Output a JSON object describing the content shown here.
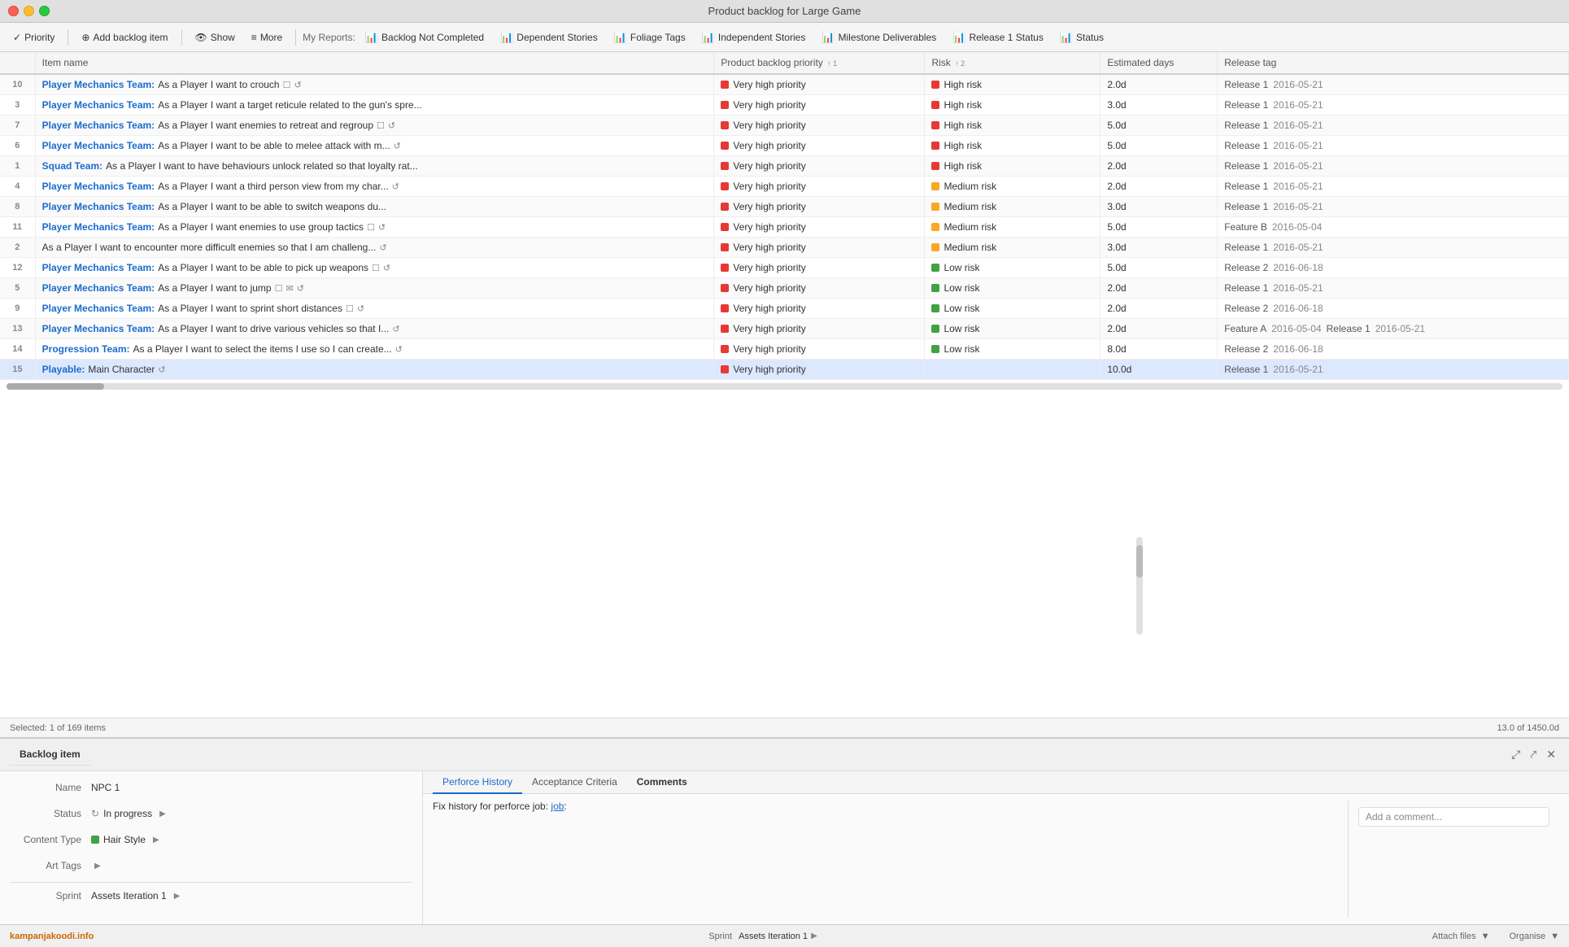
{
  "titlebar": {
    "title": "Product backlog for Large Game"
  },
  "toolbar": {
    "priority_label": "Priority",
    "add_backlog_label": "Add backlog item",
    "show_label": "Show",
    "more_label": "More",
    "reports_label": "My Reports:",
    "items": [
      "Backlog Not Completed",
      "Dependent Stories",
      "Foliage Tags",
      "Independent Stories",
      "Milestone Deliverables",
      "Release 1 Status",
      "Status"
    ]
  },
  "table": {
    "columns": {
      "num": "#",
      "item_name": "Item name",
      "backlog_priority": "Product backlog priority",
      "backlog_sort": "1",
      "risk": "Risk",
      "risk_sort": "2",
      "estimated_days": "Estimated days",
      "release_tag": "Release tag"
    },
    "rows": [
      {
        "num": "10",
        "team": "Player Mechanics Team:",
        "text": " As a Player I want to crouch",
        "has_checkbox": true,
        "has_chat": true,
        "priority": "Very high priority",
        "priority_color": "red",
        "risk": "High risk",
        "risk_color": "red",
        "est_days": "2.0d",
        "tags": [
          {
            "label": "Release 1",
            "date": "2016-05-21"
          }
        ]
      },
      {
        "num": "3",
        "team": "Player Mechanics Team:",
        "text": " As a Player I want a target reticule related to the gun's spre...",
        "has_checkbox": false,
        "has_chat": false,
        "priority": "Very high priority",
        "priority_color": "red",
        "risk": "High risk",
        "risk_color": "red",
        "est_days": "3.0d",
        "tags": [
          {
            "label": "Release 1",
            "date": "2016-05-21"
          }
        ]
      },
      {
        "num": "7",
        "team": "Player Mechanics Team:",
        "text": " As a Player I want enemies to retreat and regroup",
        "has_checkbox": true,
        "has_chat": true,
        "priority": "Very high priority",
        "priority_color": "red",
        "risk": "High risk",
        "risk_color": "red",
        "est_days": "5.0d",
        "tags": [
          {
            "label": "Release 1",
            "date": "2016-05-21"
          }
        ]
      },
      {
        "num": "6",
        "team": "Player Mechanics Team:",
        "text": " As a Player I want to be able to melee attack with m...",
        "has_checkbox": false,
        "has_chat": true,
        "priority": "Very high priority",
        "priority_color": "red",
        "risk": "High risk",
        "risk_color": "red",
        "est_days": "5.0d",
        "tags": [
          {
            "label": "Release 1",
            "date": "2016-05-21"
          }
        ]
      },
      {
        "num": "1",
        "team": "Squad Team:",
        "text": " As a Player I want to have behaviours unlock related so that loyalty rat...",
        "has_checkbox": false,
        "has_chat": false,
        "priority": "Very high priority",
        "priority_color": "red",
        "risk": "High risk",
        "risk_color": "red",
        "est_days": "2.0d",
        "tags": [
          {
            "label": "Release 1",
            "date": "2016-05-21"
          }
        ]
      },
      {
        "num": "4",
        "team": "Player Mechanics Team:",
        "text": " As a Player I want a third person view from my char...",
        "has_checkbox": false,
        "has_chat": true,
        "priority": "Very high priority",
        "priority_color": "red",
        "risk": "Medium risk",
        "risk_color": "yellow",
        "est_days": "2.0d",
        "tags": [
          {
            "label": "Release 1",
            "date": "2016-05-21"
          }
        ]
      },
      {
        "num": "8",
        "team": "Player Mechanics Team:",
        "text": " As a Player I want to be able to switch weapons du...",
        "has_checkbox": false,
        "has_chat": false,
        "priority": "Very high priority",
        "priority_color": "red",
        "risk": "Medium risk",
        "risk_color": "yellow",
        "est_days": "3.0d",
        "tags": [
          {
            "label": "Release 1",
            "date": "2016-05-21"
          }
        ]
      },
      {
        "num": "11",
        "team": "Player Mechanics Team:",
        "text": " As a Player I want enemies to use group tactics",
        "has_checkbox": true,
        "has_chat": true,
        "priority": "Very high priority",
        "priority_color": "red",
        "risk": "Medium risk",
        "risk_color": "yellow",
        "est_days": "5.0d",
        "tags": [
          {
            "label": "Feature B",
            "date": "2016-05-04"
          }
        ]
      },
      {
        "num": "2",
        "team": "",
        "text": "As a Player I want to encounter more difficult enemies so that I am challeng...",
        "has_checkbox": false,
        "has_chat": true,
        "priority": "Very high priority",
        "priority_color": "red",
        "risk": "Medium risk",
        "risk_color": "yellow",
        "est_days": "3.0d",
        "tags": [
          {
            "label": "Release 1",
            "date": "2016-05-21"
          }
        ]
      },
      {
        "num": "12",
        "team": "Player Mechanics Team:",
        "text": " As a Player I want to be able to pick up weapons",
        "has_checkbox": true,
        "has_chat": true,
        "priority": "Very high priority",
        "priority_color": "red",
        "risk": "Low risk",
        "risk_color": "green",
        "est_days": "5.0d",
        "tags": [
          {
            "label": "Release 2",
            "date": "2016-06-18"
          }
        ]
      },
      {
        "num": "5",
        "team": "Player Mechanics Team:",
        "text": " As a Player I want to jump",
        "has_checkbox": true,
        "has_mail": true,
        "has_chat2": true,
        "priority": "Very high priority",
        "priority_color": "red",
        "risk": "Low risk",
        "risk_color": "green",
        "est_days": "2.0d",
        "tags": [
          {
            "label": "Release 1",
            "date": "2016-05-21"
          }
        ]
      },
      {
        "num": "9",
        "team": "Player Mechanics Team:",
        "text": " As a Player I want to sprint short distances",
        "has_checkbox": true,
        "has_chat": true,
        "priority": "Very high priority",
        "priority_color": "red",
        "risk": "Low risk",
        "risk_color": "green",
        "est_days": "2.0d",
        "tags": [
          {
            "label": "Release 2",
            "date": "2016-06-18"
          }
        ]
      },
      {
        "num": "13",
        "team": "Player Mechanics Team:",
        "text": " As a Player I want to drive various vehicles so that I...",
        "has_checkbox": false,
        "has_chat": true,
        "priority": "Very high priority",
        "priority_color": "red",
        "risk": "Low risk",
        "risk_color": "green",
        "est_days": "2.0d",
        "tags": [
          {
            "label": "Feature A",
            "date": "2016-05-04"
          },
          {
            "label": "Release 1",
            "date": "2016-05-21"
          }
        ]
      },
      {
        "num": "14",
        "team": "Progression Team:",
        "text": " As a Player I want to select the items I use so I can create...",
        "has_checkbox": false,
        "has_chat": true,
        "priority": "Very high priority",
        "priority_color": "red",
        "risk": "Low risk",
        "risk_color": "green",
        "est_days": "8.0d",
        "tags": [
          {
            "label": "Release 2",
            "date": "2016-06-18"
          }
        ]
      },
      {
        "num": "15",
        "team": "Playable:",
        "text": " Main Character",
        "has_checkbox": false,
        "has_chat": true,
        "priority": "Very high priority",
        "priority_color": "red",
        "risk": "",
        "risk_color": "",
        "est_days": "10.0d",
        "tags": [
          {
            "label": "Release 1",
            "date": "2016-05-21"
          }
        ]
      }
    ]
  },
  "status_bar": {
    "selected": "Selected: 1 of 169 items",
    "total": "13.0 of 1450.0d"
  },
  "detail": {
    "header": "Backlog item",
    "fields": {
      "name_label": "Name",
      "name_value": "NPC 1",
      "status_label": "Status",
      "status_value": "In progress",
      "content_type_label": "Content Type",
      "content_type_value": "Hair Style",
      "art_tags_label": "Art Tags",
      "sprint_label": "Sprint",
      "sprint_value": "Assets Iteration 1"
    },
    "tabs": [
      "Perforce History",
      "Acceptance Criteria",
      "Comments"
    ],
    "active_tab": "Perforce History",
    "perforce_text": "Fix history for perforce job:",
    "comments_placeholder": "Add a comment...",
    "actions": {
      "expand": "⤢",
      "popout": "⤤",
      "close": "✕"
    }
  },
  "bottom": {
    "watermark": "kampanjakoodi.info",
    "attach_files_label": "Attach files",
    "organise_label": "Organise"
  }
}
